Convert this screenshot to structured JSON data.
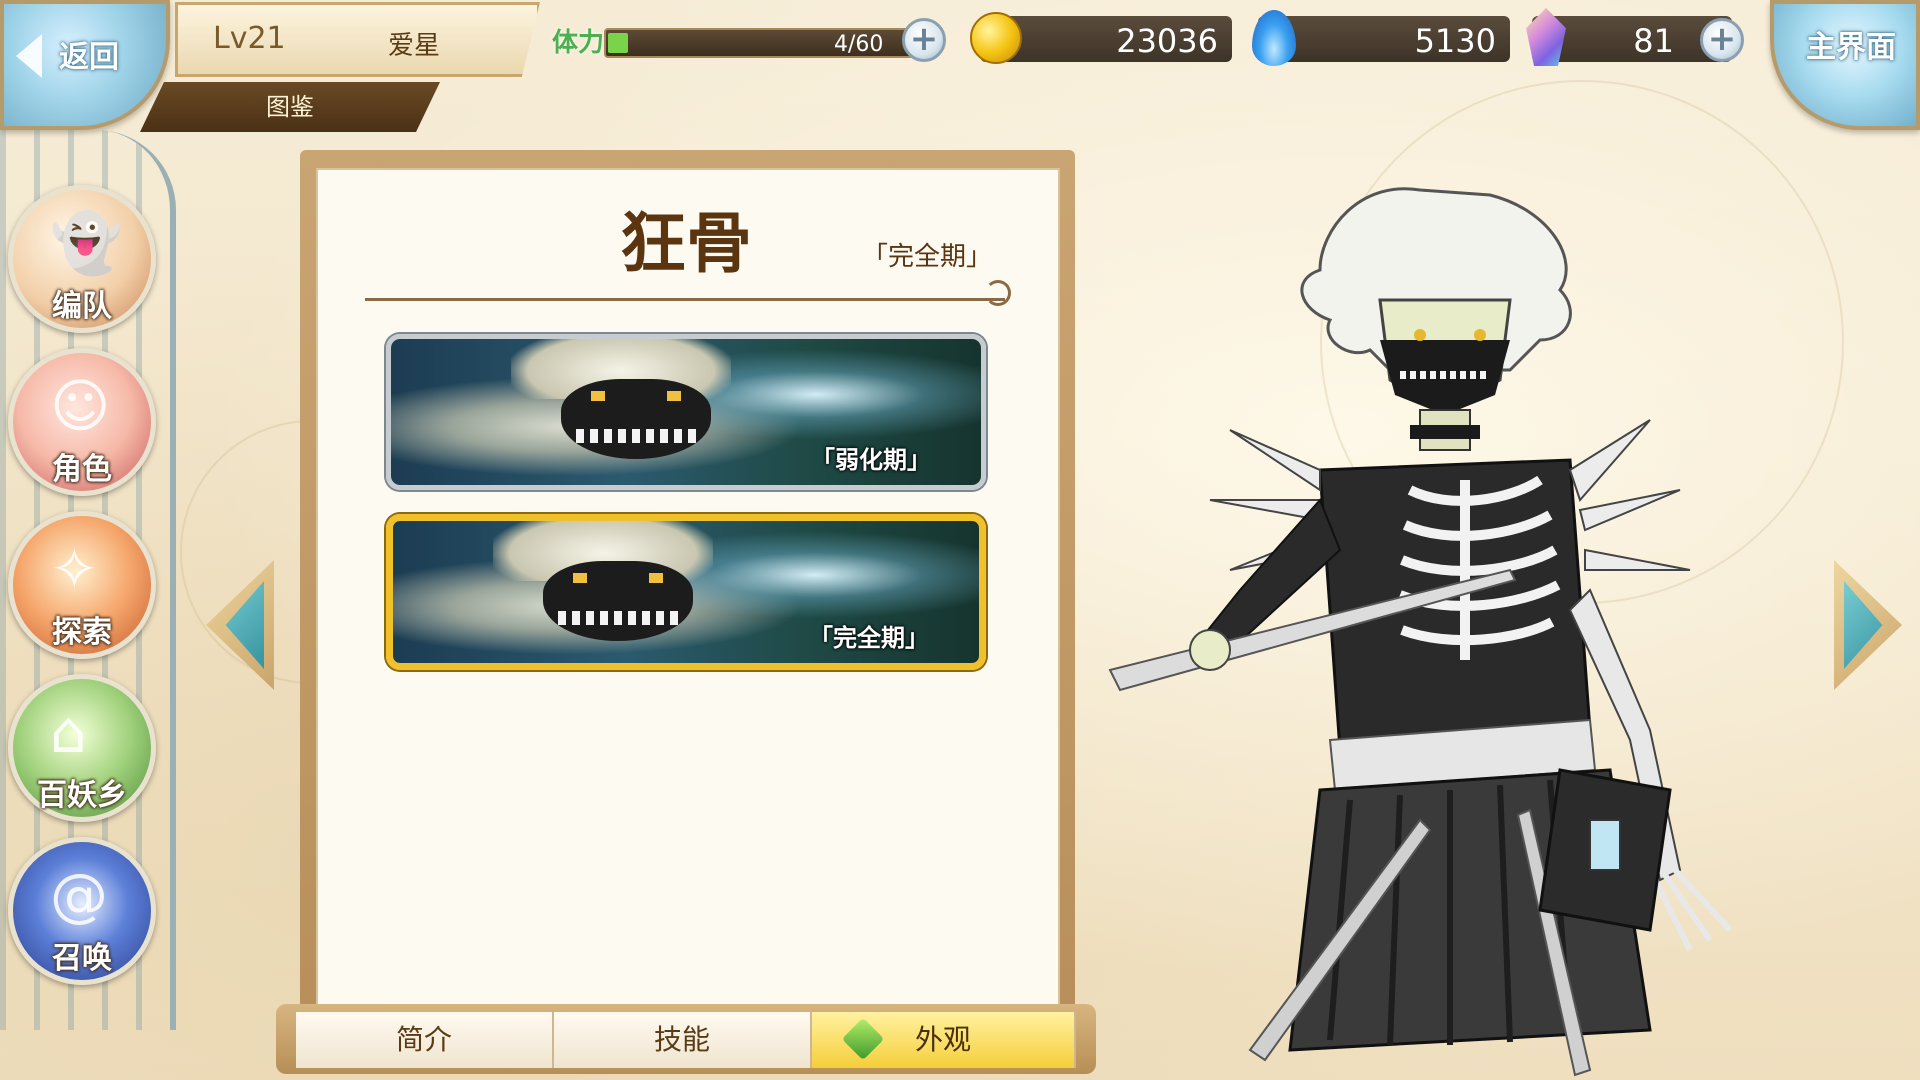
{
  "header": {
    "back_label": "返回",
    "level": "Lv21",
    "player_name": "爱星",
    "page_title": "图鉴",
    "home_label": "主界面"
  },
  "stamina": {
    "label": "体力",
    "value_text": "4/60",
    "fill_fraction": 0.067
  },
  "currencies": {
    "gold": "23036",
    "soul_fire": "5130",
    "crystal": "81"
  },
  "nav": {
    "items": [
      {
        "label": "编队",
        "icon": "ghost-team-icon",
        "color": "#f2cfa8"
      },
      {
        "label": "角色",
        "icon": "character-portrait-icon",
        "color": "#f6b9a8"
      },
      {
        "label": "探索",
        "icon": "scroll-compass-icon",
        "color": "#f5a56a"
      },
      {
        "label": "百妖乡",
        "icon": "village-house-icon",
        "color": "#9fd07a"
      },
      {
        "label": "召唤",
        "icon": "summon-swirl-icon",
        "color": "#5c7fd8"
      }
    ]
  },
  "book": {
    "character_name": "狂骨",
    "current_stage": "「完全期」",
    "skins": [
      {
        "tag": "「弱化期」",
        "selected": false
      },
      {
        "tag": "「完全期」",
        "selected": true
      }
    ]
  },
  "tabs": [
    {
      "label": "简介",
      "active": false
    },
    {
      "label": "技能",
      "active": false
    },
    {
      "label": "外观",
      "active": true
    }
  ],
  "colors": {
    "selected_border": "#f0c12a",
    "stamina_fill": "#7ad44a",
    "panel_brown": "#5a3510"
  }
}
